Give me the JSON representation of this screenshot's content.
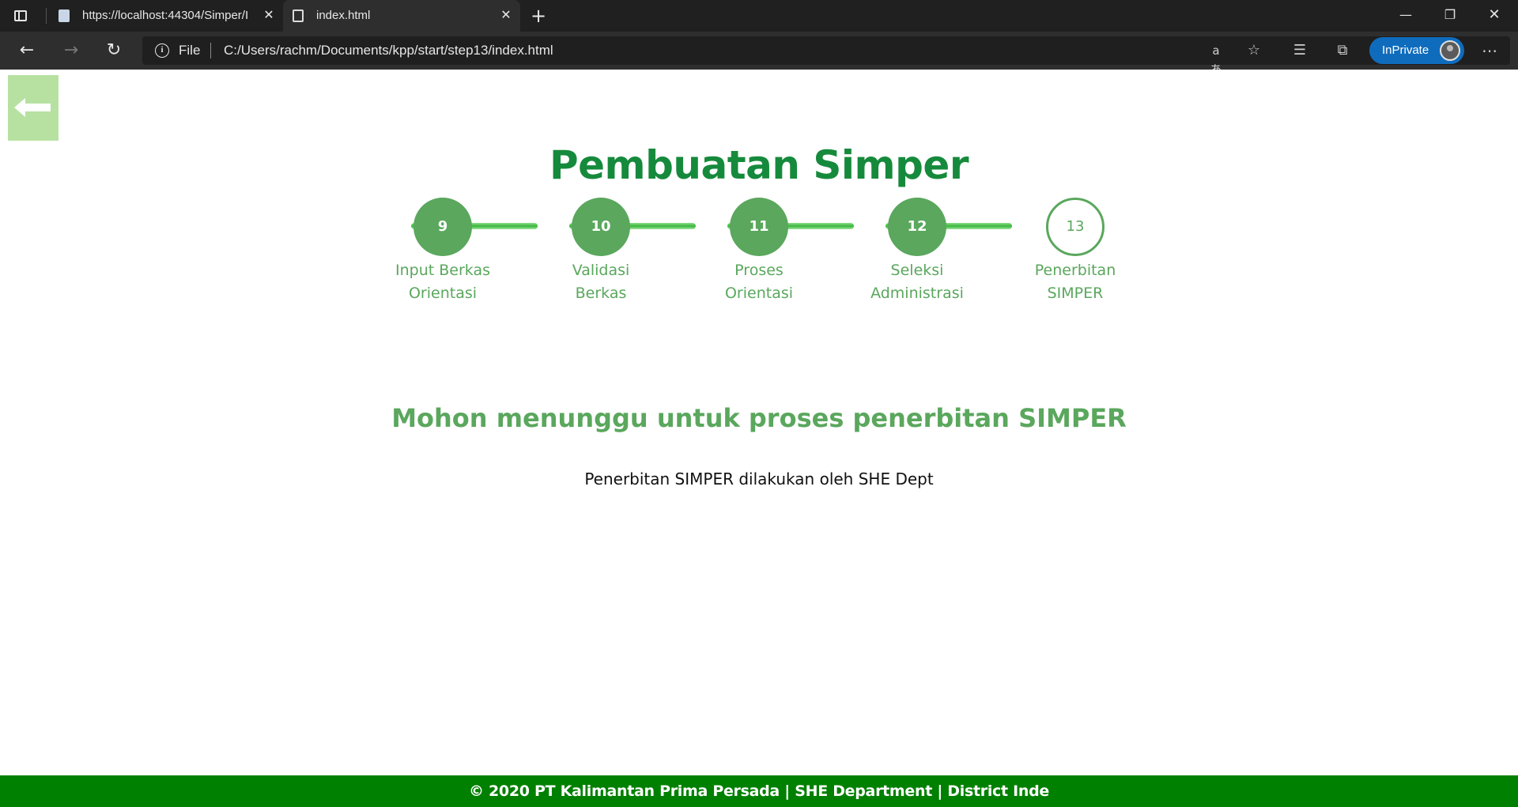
{
  "browser": {
    "tabs": [
      {
        "title": "https://localhost:44304/Simper/I",
        "active": false
      },
      {
        "title": "index.html",
        "active": true
      }
    ],
    "address": {
      "scheme": "File",
      "url": "C:/Users/rachm/Documents/kpp/start/step13/index.html"
    },
    "inprivate_label": "InPrivate",
    "icons": {
      "tab_actions": "tab-actions-icon",
      "back": "←",
      "forward": "→",
      "reload": "↻",
      "info": "i",
      "read_aloud": "aあ",
      "add_favorite": "☆",
      "favorites": "☰",
      "collections": "⧉",
      "more": "⋯",
      "new_tab": "+",
      "close": "✕",
      "minimize": "—",
      "maximize": "❐",
      "window_close": "✕"
    }
  },
  "page": {
    "back_icon": "arrow-left-icon",
    "title": "Pembuatan Simper",
    "steps": [
      {
        "number": "9",
        "label_line1": "Input Berkas",
        "label_line2": "Orientasi",
        "status": "done"
      },
      {
        "number": "10",
        "label_line1": "Validasi",
        "label_line2": "Berkas",
        "status": "done"
      },
      {
        "number": "11",
        "label_line1": "Proses",
        "label_line2": "Orientasi",
        "status": "done"
      },
      {
        "number": "12",
        "label_line1": "Seleksi",
        "label_line2": "Administrasi",
        "status": "done"
      },
      {
        "number": "13",
        "label_line1": "Penerbitan",
        "label_line2": "SIMPER",
        "status": "current"
      }
    ],
    "subtitle": "Mohon menunggu untuk proses penerbitan SIMPER",
    "description": "Penerbitan SIMPER dilakukan oleh SHE Dept",
    "footer": "© 2020 PT Kalimantan Prima Persada | SHE Department | District Inde"
  },
  "colors": {
    "brand_green": "#168a3c",
    "step_green": "#5aa75d",
    "footer_green": "#008000",
    "back_button_bg": "#b7e1a1"
  }
}
